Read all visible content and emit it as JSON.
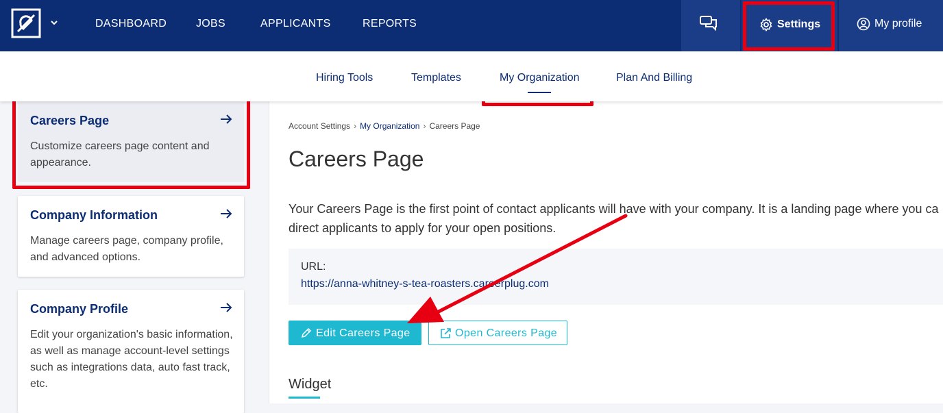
{
  "topnav": {
    "links": [
      "DASHBOARD",
      "JOBS",
      "APPLICANTS",
      "REPORTS"
    ],
    "settings_label": "Settings",
    "profile_label": "My profile"
  },
  "subnav": {
    "tabs": [
      "Hiring Tools",
      "Templates",
      "My Organization",
      "Plan And Billing"
    ],
    "active": "My Organization"
  },
  "sidebar": {
    "cards": [
      {
        "title": "Careers Page",
        "desc": "Customize careers page content and appearance.",
        "active": true
      },
      {
        "title": "Company Information",
        "desc": "Manage careers page, company profile, and advanced options.",
        "active": false
      },
      {
        "title": "Company Profile",
        "desc": "Edit your organization's basic information, as well as manage account-level settings such as integrations data, auto fast track, etc.",
        "active": false
      }
    ]
  },
  "main": {
    "breadcrumb": [
      "Account Settings",
      "My Organization",
      "Careers Page"
    ],
    "title": "Careers Page",
    "intro_line1": "Your Careers Page is the first point of contact applicants will have with your company. It is a landing page where you ca",
    "intro_line2": "direct applicants to apply for your open positions.",
    "url_label": "URL:",
    "url_value": "https://anna-whitney-s-tea-roasters.careerplug.com",
    "edit_button": "Edit Careers Page",
    "open_button": "Open Careers Page",
    "section_title": "Widget"
  },
  "colors": {
    "navy": "#0c2d74",
    "accent": "#1fb8d1",
    "annotation_red": "#e60012"
  }
}
